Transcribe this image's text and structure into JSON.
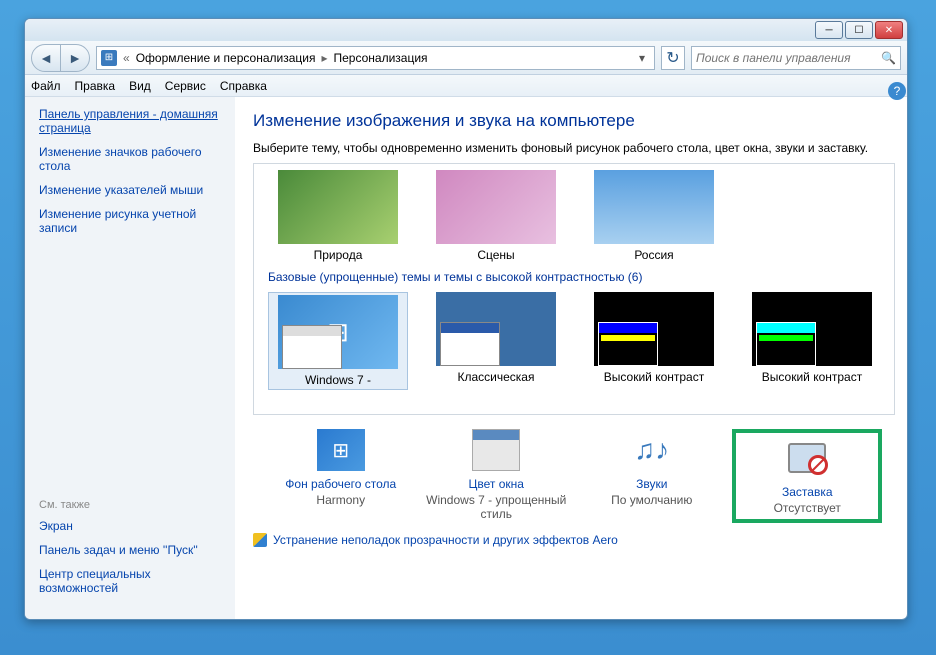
{
  "breadcrumb": {
    "l1": "Оформление и персонализация",
    "l2": "Персонализация"
  },
  "search": {
    "placeholder": "Поиск в панели управления"
  },
  "menu": {
    "file": "Файл",
    "edit": "Правка",
    "view": "Вид",
    "tools": "Сервис",
    "help": "Справка"
  },
  "sidebar": {
    "home": "Панель управления - домашняя страница",
    "l1": "Изменение значков рабочего стола",
    "l2": "Изменение указателей мыши",
    "l3": "Изменение рисунка учетной записи",
    "seealso": "См. также",
    "s1": "Экран",
    "s2": "Панель задач и меню ''Пуск''",
    "s3": "Центр специальных возможностей"
  },
  "page": {
    "title": "Изменение изображения и звука на компьютере",
    "desc": "Выберите тему, чтобы одновременно изменить фоновый рисунок рабочего стола, цвет окна, звуки и заставку."
  },
  "themes": {
    "aero": {
      "nature": "Природа",
      "scenes": "Сцены",
      "russia": "Россия"
    },
    "section_basic": "Базовые (упрощенные) темы и темы с высокой контрастностью (6)",
    "basic": {
      "win7": "Windows 7 -",
      "classic": "Классическая",
      "hc1": "Высокий контраст",
      "hc2": "Высокий контраст"
    }
  },
  "bottom": {
    "bg": {
      "label": "Фон рабочего стола",
      "value": "Harmony"
    },
    "color": {
      "label": "Цвет окна",
      "value": "Windows 7 - упрощенный стиль"
    },
    "sound": {
      "label": "Звуки",
      "value": "По умолчанию"
    },
    "ss": {
      "label": "Заставка",
      "value": "Отсутствует"
    }
  },
  "troubleshoot": "Устранение неполадок прозрачности и других эффектов Aero"
}
